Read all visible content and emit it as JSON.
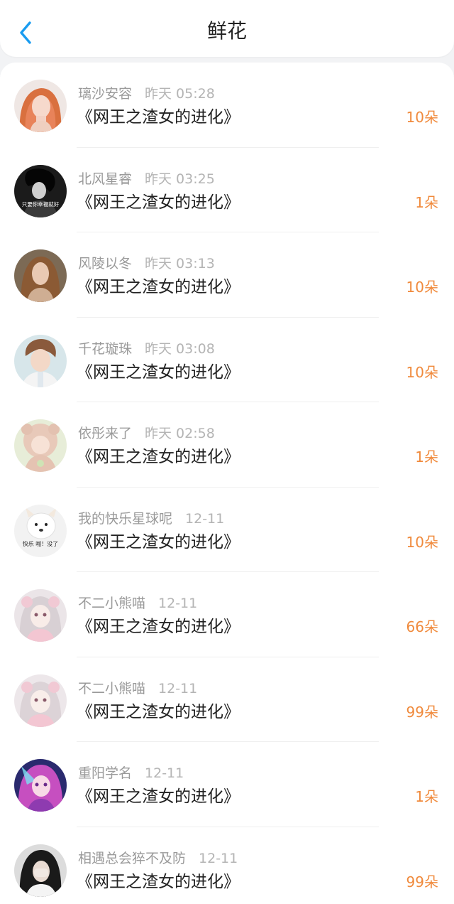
{
  "header": {
    "title": "鲜花",
    "back_icon": "chevron-left-icon",
    "accent_color": "#1a9cf0"
  },
  "colors": {
    "count": "#f08a3c",
    "meta": "#9a9a9a",
    "text": "#222222"
  },
  "items": [
    {
      "name": "璃沙安容",
      "time": "昨天 05:28",
      "book": "《网王之渣女的进化》",
      "count": "10朵"
    },
    {
      "name": "北风星睿",
      "time": "昨天 03:25",
      "book": "《网王之渣女的进化》",
      "count": "1朵",
      "avatar_text": "只要你幸福就好"
    },
    {
      "name": "风陵以冬",
      "time": "昨天 03:13",
      "book": "《网王之渣女的进化》",
      "count": "10朵"
    },
    {
      "name": "千花璇珠",
      "time": "昨天 03:08",
      "book": "《网王之渣女的进化》",
      "count": "10朵"
    },
    {
      "name": "依彤来了",
      "time": "昨天 02:58",
      "book": "《网王之渣女的进化》",
      "count": "1朵"
    },
    {
      "name": "我的快乐星球呢",
      "time": "12-11",
      "book": "《网王之渣女的进化》",
      "count": "10朵",
      "avatar_text": "快乐 啪！没了"
    },
    {
      "name": "不二小熊喵",
      "time": "12-11",
      "book": "《网王之渣女的进化》",
      "count": "66朵"
    },
    {
      "name": "不二小熊喵",
      "time": "12-11",
      "book": "《网王之渣女的进化》",
      "count": "99朵"
    },
    {
      "name": "重阳学名",
      "time": "12-11",
      "book": "《网王之渣女的进化》",
      "count": "1朵"
    },
    {
      "name": "相遇总会猝不及防",
      "time": "12-11",
      "book": "《网王之渣女的进化》",
      "count": "99朵"
    }
  ]
}
